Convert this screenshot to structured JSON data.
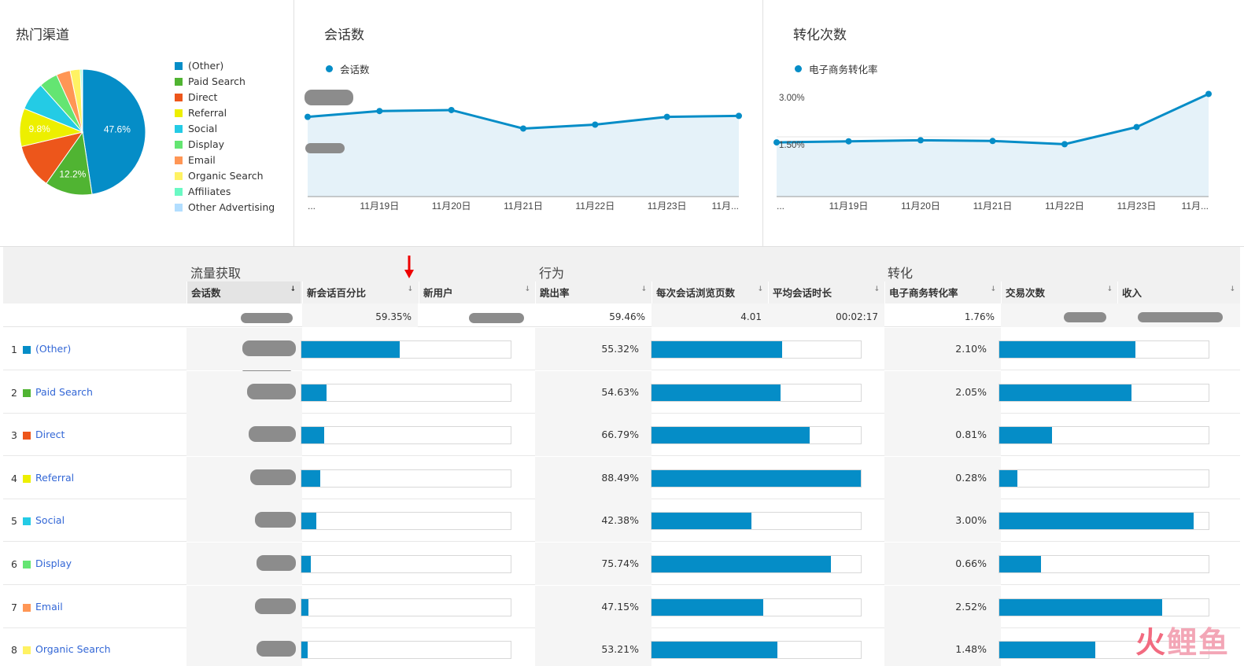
{
  "panels": {
    "channels_title": "热门渠道",
    "sessions_title": "会话数",
    "conversions_title": "转化次数"
  },
  "pie": {
    "labels_on_chart": [
      "47.6%",
      "12.2%",
      "9.8%"
    ],
    "slices": [
      {
        "name": "(Other)",
        "pct": 47.6,
        "color": "#058dc7"
      },
      {
        "name": "Paid Search",
        "pct": 12.2,
        "color": "#50b432"
      },
      {
        "name": "Direct",
        "pct": 11.5,
        "color": "#ed561b"
      },
      {
        "name": "Referral",
        "pct": 9.8,
        "color": "#edef00"
      },
      {
        "name": "Social",
        "pct": 7.3,
        "color": "#24cbe5"
      },
      {
        "name": "Display",
        "pct": 4.8,
        "color": "#64e572"
      },
      {
        "name": "Email",
        "pct": 3.6,
        "color": "#ff9655"
      },
      {
        "name": "Organic Search",
        "pct": 2.6,
        "color": "#fff263"
      },
      {
        "name": "Affiliates",
        "pct": 0.4,
        "color": "#6af9c4"
      },
      {
        "name": "Other Advertising",
        "pct": 0.2,
        "color": "#b2deff"
      }
    ]
  },
  "sessions_chart": {
    "legend": "会话数",
    "x_labels": [
      "...",
      "11月19日",
      "11月20日",
      "11月21日",
      "11月22日",
      "11月23日",
      "11月..."
    ],
    "values": [
      0.82,
      0.88,
      0.89,
      0.7,
      0.74,
      0.82,
      0.83
    ]
  },
  "conversion_chart": {
    "legend": "电子商务转化率",
    "y_labels": [
      "3.00%",
      "1.50%"
    ],
    "x_labels": [
      "...",
      "11月19日",
      "11月20日",
      "11月21日",
      "11月22日",
      "11月23日",
      "11月..."
    ],
    "values": [
      1.52,
      1.55,
      1.58,
      1.56,
      1.47,
      1.95,
      2.88
    ]
  },
  "table": {
    "groups": [
      "流量获取",
      "行为",
      "转化"
    ],
    "headers": [
      "会话数",
      "新会话百分比",
      "新用户",
      "跳出率",
      "每次会话浏览页数",
      "平均会话时长",
      "电子商务转化率",
      "交易次数",
      "收入"
    ],
    "totals": {
      "new_session_pct": "59.35%",
      "bounce_rate": "59.46%",
      "pages_per_session": "4.01",
      "avg_duration": "00:02:17",
      "ecommerce_rate": "1.76%"
    },
    "rows": [
      {
        "num": "1",
        "name": "(Other)",
        "color": "#058dc7",
        "new_pct_level": 0.47,
        "bounce": "55.32%",
        "bounce_level": 0.625,
        "conv": "2.10%",
        "conv_level": 0.65
      },
      {
        "num": "2",
        "name": "Paid Search",
        "color": "#50b432",
        "new_pct_level": 0.12,
        "bounce": "54.63%",
        "bounce_level": 0.617,
        "conv": "2.05%",
        "conv_level": 0.63
      },
      {
        "num": "3",
        "name": "Direct",
        "color": "#ed561b",
        "new_pct_level": 0.11,
        "bounce": "66.79%",
        "bounce_level": 0.755,
        "conv": "0.81%",
        "conv_level": 0.25
      },
      {
        "num": "4",
        "name": "Referral",
        "color": "#edef00",
        "new_pct_level": 0.09,
        "bounce": "88.49%",
        "bounce_level": 1.0,
        "conv": "0.28%",
        "conv_level": 0.085
      },
      {
        "num": "5",
        "name": "Social",
        "color": "#24cbe5",
        "new_pct_level": 0.07,
        "bounce": "42.38%",
        "bounce_level": 0.479,
        "conv": "3.00%",
        "conv_level": 0.93
      },
      {
        "num": "6",
        "name": "Display",
        "color": "#64e572",
        "new_pct_level": 0.045,
        "bounce": "75.74%",
        "bounce_level": 0.856,
        "conv": "0.66%",
        "conv_level": 0.2
      },
      {
        "num": "7",
        "name": "Email",
        "color": "#ff9655",
        "new_pct_level": 0.035,
        "bounce": "47.15%",
        "bounce_level": 0.533,
        "conv": "2.52%",
        "conv_level": 0.78
      },
      {
        "num": "8",
        "name": "Organic Search",
        "color": "#fff263",
        "new_pct_level": 0.03,
        "bounce": "53.21%",
        "bounce_level": 0.601,
        "conv": "1.48%",
        "conv_level": 0.46
      }
    ]
  },
  "watermark": {
    "fire": "火",
    "rest": "鲤鱼"
  }
}
